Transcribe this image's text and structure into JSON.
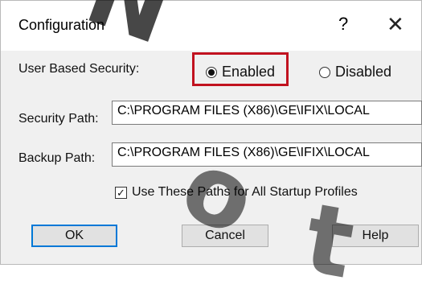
{
  "window": {
    "title": "Configuration",
    "help_glyph": "?",
    "close_glyph": "✕"
  },
  "security": {
    "label": "User Based Security:",
    "enabled_label": "Enabled",
    "disabled_label": "Disabled",
    "selected": "Enabled"
  },
  "paths": {
    "security_label": "Security Path:",
    "security_value": "C:\\PROGRAM FILES (X86)\\GE\\IFIX\\LOCAL",
    "backup_label": "Backup Path:",
    "backup_value": "C:\\PROGRAM FILES (X86)\\GE\\IFIX\\LOCAL"
  },
  "options": {
    "use_paths_label": "Use These Paths for All Startup Profiles",
    "use_paths_checked": true
  },
  "buttons": {
    "ok": "OK",
    "cancel": "Cancel",
    "help": "Help"
  },
  "colors": {
    "highlight": "#c1121f",
    "default_button_border": "#0078d7"
  }
}
